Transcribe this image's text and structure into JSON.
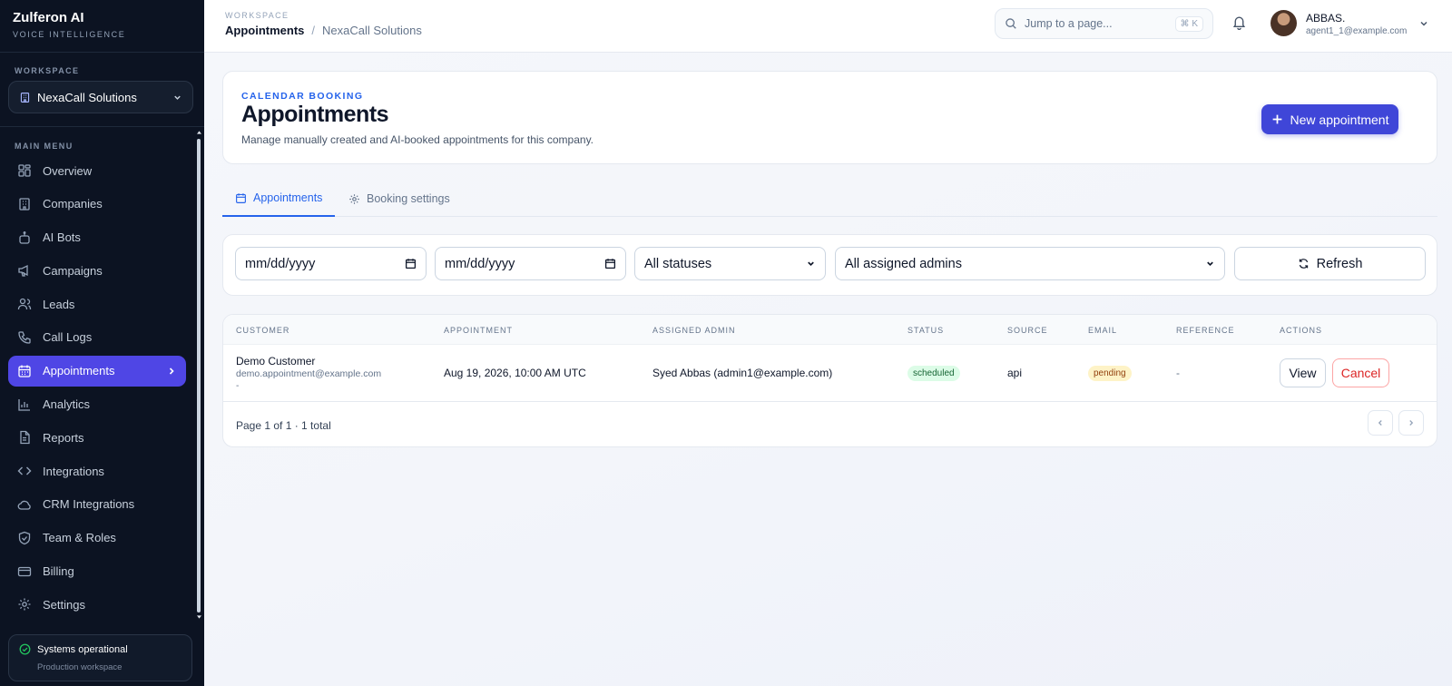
{
  "brand": {
    "name": "Zulferon AI",
    "tagline": "VOICE INTELLIGENCE"
  },
  "sidebar": {
    "workspace_label": "WORKSPACE",
    "workspace_value": "NexaCall Solutions",
    "menu_label": "MAIN MENU",
    "items": [
      {
        "label": "Overview",
        "icon": "grid-icon"
      },
      {
        "label": "Companies",
        "icon": "building-icon"
      },
      {
        "label": "AI Bots",
        "icon": "bot-icon"
      },
      {
        "label": "Campaigns",
        "icon": "megaphone-icon"
      },
      {
        "label": "Leads",
        "icon": "users-icon"
      },
      {
        "label": "Call Logs",
        "icon": "phone-icon"
      },
      {
        "label": "Appointments",
        "icon": "calendar-icon",
        "active": true
      },
      {
        "label": "Analytics",
        "icon": "bar-chart-icon"
      },
      {
        "label": "Reports",
        "icon": "file-icon"
      },
      {
        "label": "Integrations",
        "icon": "code-icon"
      },
      {
        "label": "CRM Integrations",
        "icon": "cloud-icon"
      },
      {
        "label": "Team & Roles",
        "icon": "shield-icon"
      },
      {
        "label": "Billing",
        "icon": "credit-card-icon"
      },
      {
        "label": "Settings",
        "icon": "gear-icon"
      }
    ],
    "status": {
      "title": "Systems operational",
      "subtitle": "Production workspace"
    }
  },
  "topbar": {
    "workspace_label": "WORKSPACE",
    "breadcrumb": {
      "current": "Appointments",
      "separator": "/",
      "parent": "NexaCall Solutions"
    },
    "search": {
      "placeholder": "Jump to a page...",
      "shortcut": "⌘ K"
    },
    "user": {
      "name": "ABBAS.",
      "email": "agent1_1@example.com"
    }
  },
  "header": {
    "eyebrow": "CALENDAR BOOKING",
    "title": "Appointments",
    "description": "Manage manually created and AI-booked appointments for this company.",
    "new_button": "New appointment"
  },
  "tabs": [
    {
      "label": "Appointments",
      "active": true
    },
    {
      "label": "Booking settings",
      "active": false
    }
  ],
  "filters": {
    "date_from": "mm/dd/yyyy",
    "date_to": "mm/dd/yyyy",
    "status": "All statuses",
    "admin": "All assigned admins",
    "refresh": "Refresh"
  },
  "table": {
    "columns": [
      "CUSTOMER",
      "APPOINTMENT",
      "ASSIGNED ADMIN",
      "STATUS",
      "SOURCE",
      "EMAIL",
      "REFERENCE",
      "ACTIONS"
    ],
    "rows": [
      {
        "customer_name": "Demo Customer",
        "customer_email": "demo.appointment@example.com",
        "customer_phone": "-",
        "appointment": "Aug 19, 2026, 10:00 AM UTC",
        "admin": "Syed Abbas (admin1@example.com)",
        "status": "scheduled",
        "source": "api",
        "email": "pending",
        "reference": "-",
        "view": "View",
        "cancel": "Cancel"
      }
    ],
    "pagination": "Page 1 of 1 · 1 total"
  },
  "colors": {
    "sidebar_bg": "#0c1322",
    "accent": "#4f46e5",
    "primary_button": "#3f46d8",
    "link": "#2563eb",
    "danger": "#dc2626"
  }
}
